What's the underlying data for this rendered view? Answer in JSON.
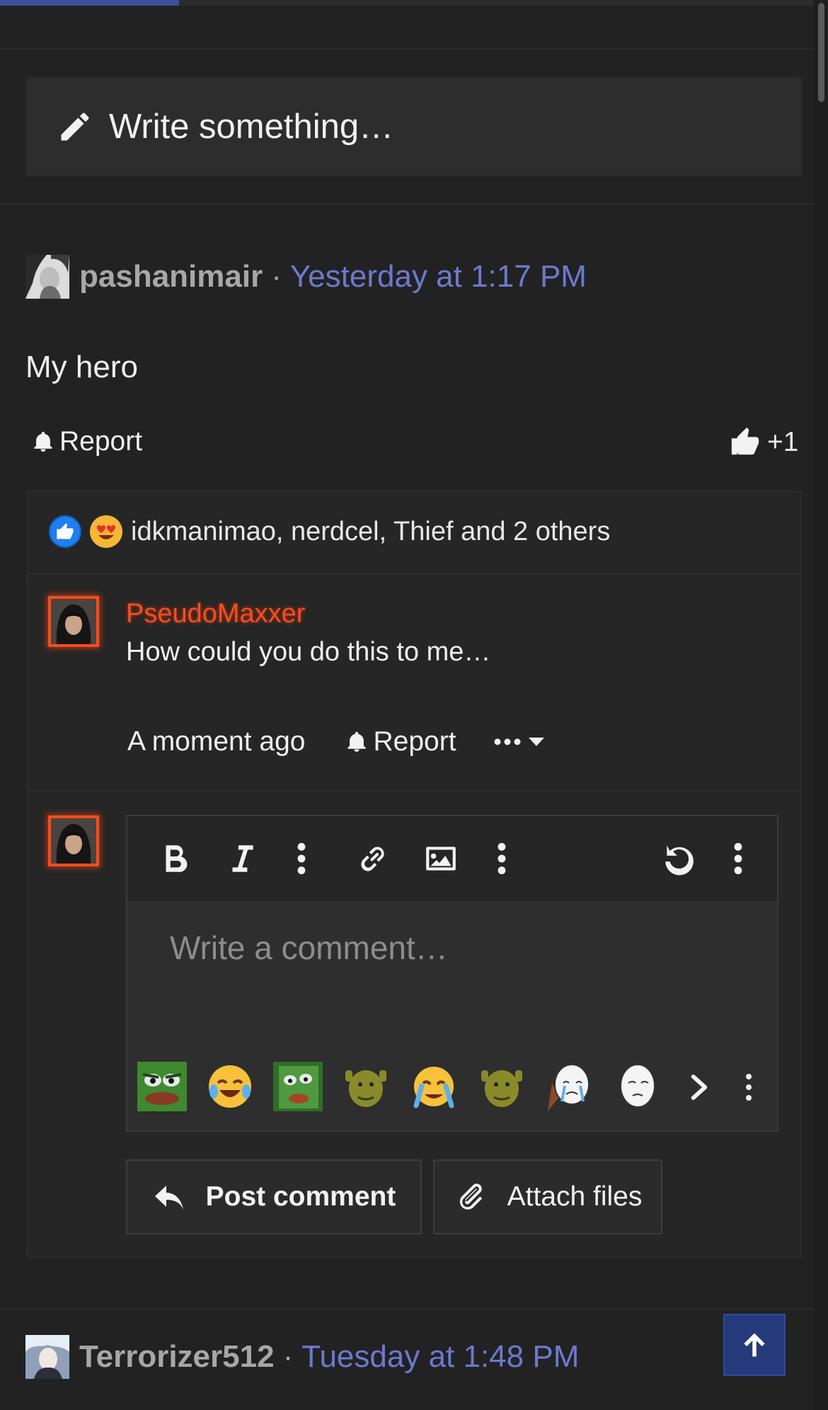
{
  "progress": {
    "value_percent": 22
  },
  "composer": {
    "placeholder": "Write something…"
  },
  "post1": {
    "username": "pashanimair",
    "separator": "·",
    "time": "Yesterday at 1:17 PM",
    "body": "My hero",
    "report_label": "Report",
    "like_count": "+1",
    "reactions_text": "idkmanimao, nerdcel, Thief and 2 others"
  },
  "comment": {
    "username": "PseudoMaxxer",
    "text": "How could you do this to me…",
    "time": "A moment ago",
    "report_label": "Report"
  },
  "editor": {
    "placeholder": "Write a comment…",
    "toolbar": [
      "bold-icon",
      "italic-icon",
      "more-vertical-icon",
      "link-icon",
      "image-icon",
      "more-vertical-icon",
      "undo-icon",
      "more-vertical-icon"
    ],
    "emojis": [
      "pepe-angry",
      "crying-laughing",
      "pepe-green",
      "shrek",
      "crying-face",
      "shrek",
      "wojak-crying",
      "wojak-face"
    ]
  },
  "buttons": {
    "post_comment": "Post comment",
    "attach_files": "Attach files"
  },
  "post2": {
    "username": "Terrorizer512",
    "separator": "·",
    "time": "Tuesday at 1:48 PM"
  },
  "colors": {
    "background": "#222222",
    "accent_link": "#6b79cf",
    "comment_user": "#ff4a1a",
    "scroll_top": "#243a7a"
  }
}
